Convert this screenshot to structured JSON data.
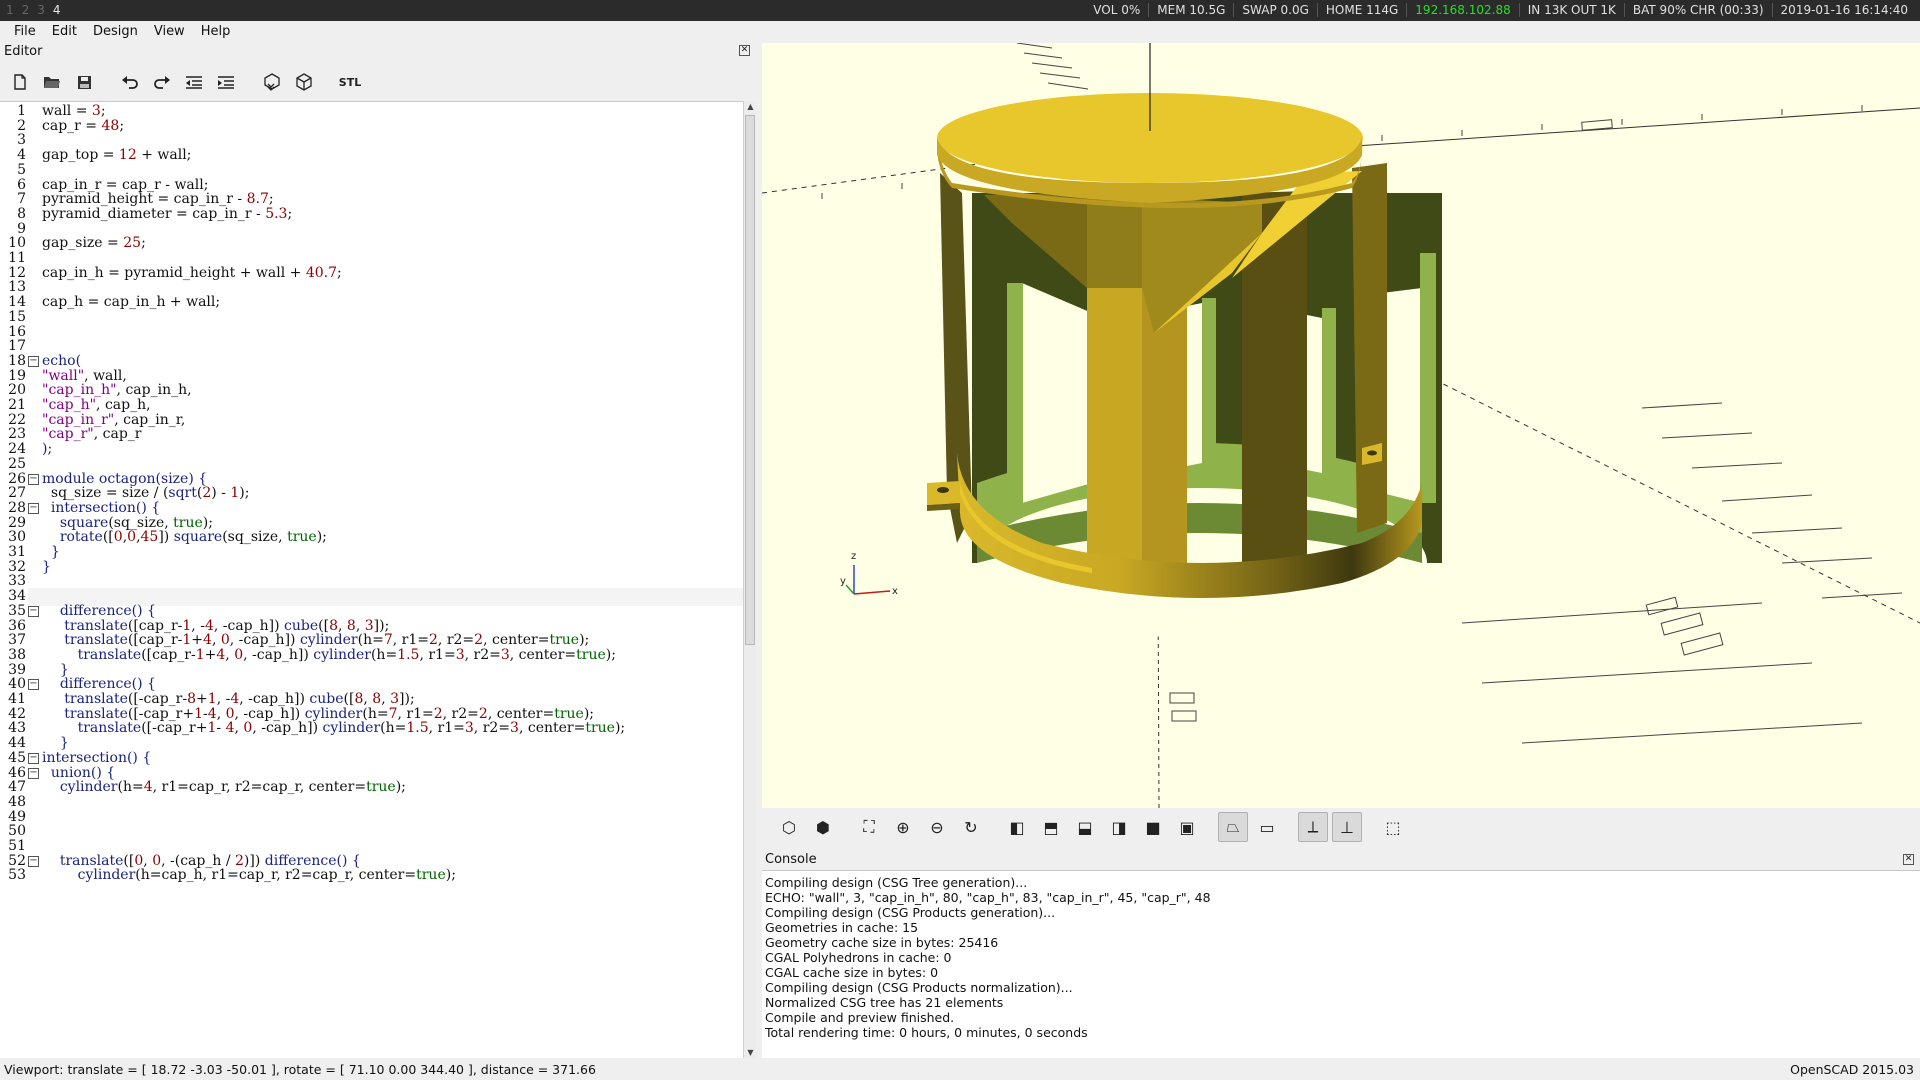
{
  "topbar": {
    "workspaces": [
      "1",
      "2",
      "3",
      "4"
    ],
    "active_workspace": "4",
    "status": [
      "VOL 0%",
      "MEM 10.5G",
      "SWAP 0.0G",
      "HOME 114G",
      "192.168.102.88",
      "IN 13K OUT 1K",
      "BAT 90% CHR (00:33)",
      "2019-01-16 16:14:40"
    ]
  },
  "menu": [
    "File",
    "Edit",
    "Design",
    "View",
    "Help"
  ],
  "editor": {
    "title": "Editor",
    "toolbar": [
      "new-file-icon",
      "open-file-icon",
      "save-icon",
      "undo-icon",
      "redo-icon",
      "unindent-icon",
      "indent-icon",
      "preview-icon",
      "render-icon"
    ],
    "stl_label": "STL",
    "lines": [
      "<span>wall = </span><span class=\"num\">3</span>;",
      "cap_r = <span class=\"num\">48</span>;",
      "",
      "gap_top = <span class=\"num\">12</span> + wall;",
      "",
      "cap_in_r = cap_r - wall;",
      "pyramid_height = cap_in_r - <span class=\"num\">8.7</span>;",
      "pyramid_diameter = cap_in_r - <span class=\"num\">5.3</span>;",
      "",
      "gap_size = <span class=\"num\">25</span>;",
      "",
      "cap_in_h = pyramid_height + wall + <span class=\"num\">40.7</span>;",
      "",
      "cap_h = cap_in_h + wall;",
      "",
      "",
      "",
      "<span class=\"kw\">echo(</span>",
      "<span class=\"str\">\"wall\"</span>, wall,",
      "<span class=\"str\">\"cap_in_h\"</span>, cap_in_h,",
      "<span class=\"str\">\"cap_h\"</span>, cap_h,",
      "<span class=\"str\">\"cap_in_r\"</span>, cap_in_r,",
      "<span class=\"str\">\"cap_r\"</span>, cap_r",
      "<span class=\"kw\">);</span>",
      "",
      "<span class=\"kw\">module octagon(size) {</span>",
      "  sq_size = size / (<span class=\"kw\">sqrt</span>(<span class=\"num\">2</span>) - <span class=\"num\">1</span>);",
      "  <span class=\"kw\">intersection() {</span>",
      "    <span class=\"kw\">square</span>(sq_size, <span class=\"tr\">true</span>);",
      "    <span class=\"kw\">rotate</span>([<span class=\"num\">0</span>,<span class=\"num\">0</span>,<span class=\"num\">45</span>]) <span class=\"kw\">square</span>(sq_size, <span class=\"tr\">true</span>);",
      "  <span class=\"kw\">}</span>",
      "<span class=\"kw\">}</span>",
      "",
      "",
      "    <span class=\"kw\">difference() {</span>",
      "     <span class=\"kw\">translate</span>([cap_r-<span class=\"num\">1</span>, -<span class=\"num\">4</span>, -cap_h]) <span class=\"kw\">cube</span>([<span class=\"num\">8</span>, <span class=\"num\">8</span>, <span class=\"num\">3</span>]);",
      "     <span class=\"kw\">translate</span>([cap_r-<span class=\"num\">1</span>+<span class=\"num\">4</span>, <span class=\"num\">0</span>, -cap_h]) <span class=\"kw\">cylinder</span>(h=<span class=\"num\">7</span>, r1=<span class=\"num\">2</span>, r2=<span class=\"num\">2</span>, center=<span class=\"tr\">true</span>);",
      "        <span class=\"kw\">translate</span>([cap_r-<span class=\"num\">1</span>+<span class=\"num\">4</span>, <span class=\"num\">0</span>, -cap_h]) <span class=\"kw\">cylinder</span>(h=<span class=\"num\">1.5</span>, r1=<span class=\"num\">3</span>, r2=<span class=\"num\">3</span>, center=<span class=\"tr\">true</span>);",
      "    <span class=\"kw\">}</span>",
      "    <span class=\"kw\">difference() {</span>",
      "     <span class=\"kw\">translate</span>([-cap_r-<span class=\"num\">8</span>+<span class=\"num\">1</span>, -<span class=\"num\">4</span>, -cap_h]) <span class=\"kw\">cube</span>([<span class=\"num\">8</span>, <span class=\"num\">8</span>, <span class=\"num\">3</span>]);",
      "     <span class=\"kw\">translate</span>([-cap_r+<span class=\"num\">1</span>-<span class=\"num\">4</span>, <span class=\"num\">0</span>, -cap_h]) <span class=\"kw\">cylinder</span>(h=<span class=\"num\">7</span>, r1=<span class=\"num\">2</span>, r2=<span class=\"num\">2</span>, center=<span class=\"tr\">true</span>);",
      "        <span class=\"kw\">translate</span>([-cap_r+<span class=\"num\">1</span>- <span class=\"num\">4</span>, <span class=\"num\">0</span>, -cap_h]) <span class=\"kw\">cylinder</span>(h=<span class=\"num\">1.5</span>, r1=<span class=\"num\">3</span>, r2=<span class=\"num\">3</span>, center=<span class=\"tr\">true</span>);",
      "    <span class=\"kw\">}</span>",
      "<span class=\"kw\">intersection() {</span>",
      "  <span class=\"kw\">union() {</span>",
      "    <span class=\"kw\">cylinder</span>(h=<span class=\"num\">4</span>, r1=cap_r, r2=cap_r, center=<span class=\"tr\">true</span>);",
      "",
      "",
      "",
      "",
      "    <span class=\"kw\">translate</span>([<span class=\"num\">0</span>, <span class=\"num\">0</span>, -(cap_h / <span class=\"num\">2</span>)]) <span class=\"kw\">difference() {</span>",
      "        <span class=\"kw\">cylinder</span>(h=cap_h, r1=cap_r, r2=cap_r, center=<span class=\"tr\">true</span>);"
    ],
    "fold_lines": [
      18,
      26,
      28,
      35,
      40,
      45,
      46,
      52
    ]
  },
  "view_toolbar": [
    "preview-icon",
    "render-icon",
    "view-all-icon",
    "zoom-in-icon",
    "zoom-out-icon",
    "reset-view-icon",
    "view-right-icon",
    "view-top-icon",
    "view-bottom-icon",
    "view-left-icon",
    "view-front-icon",
    "view-back-icon",
    "perspective-icon",
    "orthogonal-icon",
    "show-axes-icon",
    "show-scale-icon",
    "show-edges-icon"
  ],
  "console": {
    "title": "Console",
    "lines": [
      "Compiling design (CSG Tree generation)...",
      "ECHO: \"wall\", 3, \"cap_in_h\", 80, \"cap_h\", 83, \"cap_in_r\", 45, \"cap_r\", 48",
      "Compiling design (CSG Products generation)...",
      "Geometries in cache: 15",
      "Geometry cache size in bytes: 25416",
      "CGAL Polyhedrons in cache: 0",
      "CGAL cache size in bytes: 0",
      "Compiling design (CSG Products normalization)...",
      "Normalized CSG tree has 21 elements",
      "Compile and preview finished.",
      "Total rendering time: 0 hours, 0 minutes, 0 seconds"
    ]
  },
  "statusbar": {
    "viewport": "Viewport: translate = [ 18.72 -3.03 -50.01 ], rotate = [ 71.10 0.00 344.40 ], distance = 371.66",
    "version": "OpenSCAD 2015.03"
  },
  "axis_labels": {
    "z": "z",
    "y": "y",
    "x": "x"
  },
  "colors": {
    "model_top": "#e8c72c",
    "model_mid": "#b89a1e",
    "model_dark": "#4a4412",
    "inner_green": "#8fb34a",
    "viewport_bg": "#ffffe5"
  }
}
